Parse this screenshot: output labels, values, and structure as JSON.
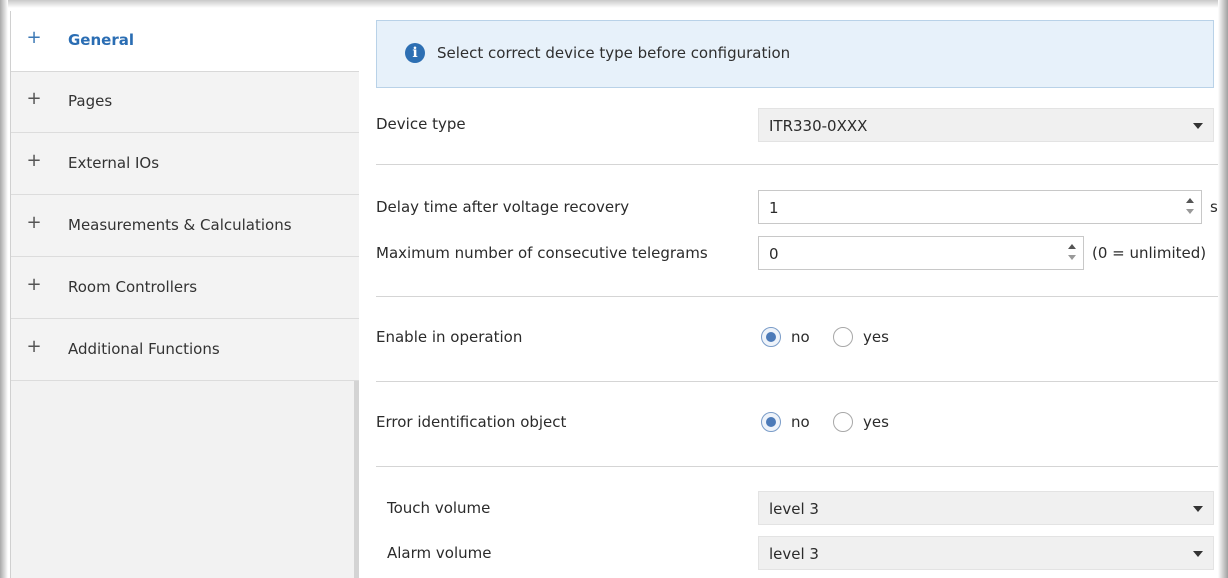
{
  "sidebar": {
    "items": [
      {
        "label": "General",
        "active": true
      },
      {
        "label": "Pages",
        "active": false
      },
      {
        "label": "External IOs",
        "active": false
      },
      {
        "label": "Measurements & Calculations",
        "active": false
      },
      {
        "label": "Room Controllers",
        "active": false
      },
      {
        "label": "Additional Functions",
        "active": false
      }
    ],
    "expand_glyph": "+"
  },
  "info": {
    "icon": "info-icon",
    "glyph": "i",
    "text": "Select correct device type before configuration"
  },
  "device_type": {
    "label": "Device type",
    "value": "ITR330-0XXX"
  },
  "delay": {
    "label": "Delay time after voltage recovery",
    "value": "1",
    "unit": "s"
  },
  "max_telegrams": {
    "label": "Maximum number of consecutive telegrams",
    "value": "0",
    "unit": "(0 = unlimited)"
  },
  "enable_operation": {
    "label": "Enable in operation",
    "options": [
      "no",
      "yes"
    ],
    "selected": "no"
  },
  "error_object": {
    "label": "Error identification object",
    "options": [
      "no",
      "yes"
    ],
    "selected": "no"
  },
  "touch_volume": {
    "label": "Touch volume",
    "value": "level 3"
  },
  "alarm_volume": {
    "label": "Alarm volume",
    "value": "level 3"
  },
  "colors": {
    "accent": "#2a6db3",
    "info_bg": "#e7f1fa",
    "sidebar_bg": "#f3f3f3"
  }
}
